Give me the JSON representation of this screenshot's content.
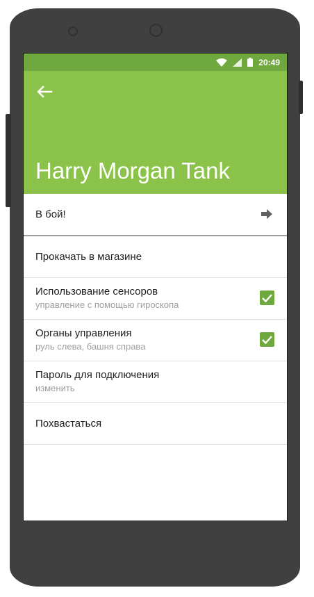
{
  "status_bar": {
    "time": "20:49",
    "icons": [
      "wifi-icon",
      "signal-icon",
      "battery-icon"
    ]
  },
  "app_bar": {
    "back_icon": "back-arrow-icon",
    "title": "Harry Morgan Tank"
  },
  "menu": {
    "items": [
      {
        "label": "В бой!",
        "icon": "arrow-right-icon"
      },
      {
        "label": "Прокачать в магазине"
      },
      {
        "label": "Использование сенсоров",
        "sublabel": "управление с помощью гироскопа",
        "checked": true
      },
      {
        "label": "Органы управления",
        "sublabel": "руль слева, башня справа",
        "checked": true
      },
      {
        "label": "Пароль для подключения",
        "sublabel": "изменить"
      },
      {
        "label": "Похвастаться"
      }
    ]
  },
  "colors": {
    "app_bar": "#8bc34a",
    "status_bar": "#6fa83e",
    "checkbox": "#6fa83e",
    "frame": "#404040"
  }
}
